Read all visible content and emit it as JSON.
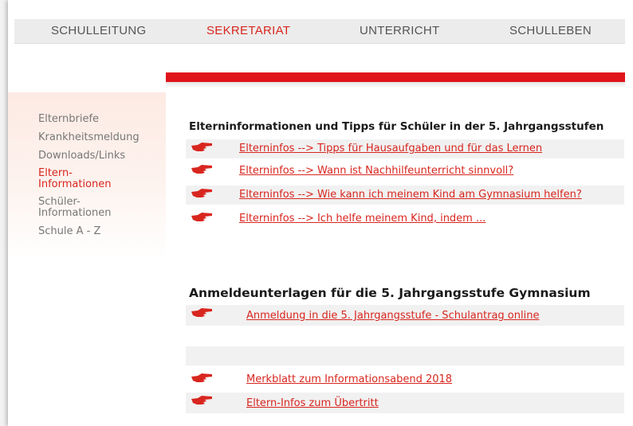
{
  "nav": {
    "items": [
      {
        "label": "SCHULLEITUNG"
      },
      {
        "label": "SEKRETARIAT"
      },
      {
        "label": "UNTERRICHT"
      },
      {
        "label": "SCHULLEBEN"
      }
    ],
    "active": "SEKRETARIAT"
  },
  "sidebar": {
    "items": [
      {
        "label": "Elternbriefe"
      },
      {
        "label": "Krankheitsmeldung"
      },
      {
        "label": "Downloads/Links"
      },
      {
        "label": "Eltern-\nInformationen"
      },
      {
        "label": "Schüler-\nInformationen"
      },
      {
        "label": "Schule A - Z"
      }
    ],
    "active": "Eltern-Informationen"
  },
  "section1": {
    "heading": "Elterninformationen und Tipps für Schüler in der 5. Jahrgangsstufen",
    "links": [
      {
        "text": "Elterninfos --> Tipps für Hausaufgaben und für das Lernen"
      },
      {
        "text": "Elterninfos --> Wann ist Nachhilfeunterricht sinnvoll?"
      },
      {
        "text": "Elterninfos --> Wie kann ich meinem Kind am Gymnasium helfen?"
      },
      {
        "text": "Elterninfos --> Ich helfe meinem Kind, indem ..."
      }
    ]
  },
  "section2": {
    "heading": "Anmeldeunterlagen für die 5. Jahrgangsstufe Gymnasium",
    "links": [
      {
        "text": "Anmeldung in die 5. Jahrgangsstufe - Schulantrag online"
      },
      {
        "text": "Merkblatt zum Informationsabend 2018"
      },
      {
        "text": "Eltern-Infos zum Übertritt"
      }
    ]
  },
  "icons": {
    "link_marker": "pointing-hand-icon"
  },
  "colors": {
    "accent": "#d8261f",
    "redbar": "#e0141b",
    "row_bg": "#f1f1f1",
    "sidebar_bg": "#fdeae3"
  }
}
